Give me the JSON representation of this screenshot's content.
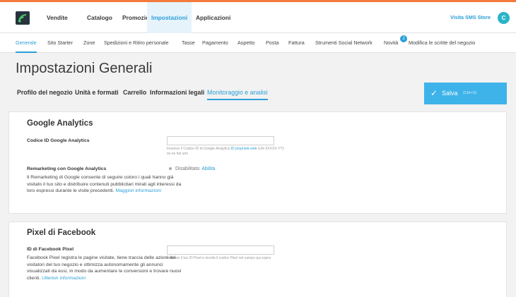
{
  "topnav": {
    "items": [
      "Vendite",
      "Catalogo",
      "Promozioni",
      "Impostazioni",
      "Applicazioni"
    ],
    "visit_store": "Visita SMS Store",
    "avatar_initial": "C"
  },
  "subnav": {
    "items": [
      "Generale",
      "Sito Starter",
      "Zone",
      "Spedizioni e Ritiro personale",
      "Tasse",
      "Pagamento",
      "Aspetto",
      "Posta",
      "Fattura",
      "Strumenti Social Network",
      "Novità",
      "Modifica le scritte del negozio"
    ],
    "news_badge": "2"
  },
  "page": {
    "title": "Impostazioni Generali",
    "tabs": [
      "Profilo del negozio",
      "Unità e formati",
      "Carrello",
      "Informazioni legali",
      "Monitoraggio e analisi"
    ],
    "save_label": "Salva",
    "save_shortcut": "(Ctrl+S)"
  },
  "google": {
    "title": "Google Analytics",
    "id_label": "Codice ID Google Analytics",
    "id_value": "",
    "id_hint": "Inserisci il Codice ID di Google Analytics,",
    "id_hint_link": "ID proprietà web",
    "id_hint_rest": " (UA-XXXXX-YY) se ne hai uno",
    "remarketing_label": "Remarketing con Google Analytics",
    "remarketing_desc": "Il Remarketing di Google consente di seguire coloro i quali hanno già visitato il tuo sito e distribuire contenuti pubblicitari mirati agli interessi da loro espressi durante le visite precedenti.",
    "remarketing_more": "Maggiori informazioni",
    "status": "Disabilitato",
    "enable": "Abilita"
  },
  "facebook": {
    "title": "Pixel di Facebook",
    "id_label": "ID di Facebook Pixel",
    "id_value": "",
    "desc": "Facebook Pixel registra le pagine visitate, tiene traccia delle azioni dei visitatori del tuo negozio e ottimizza autonomamente gli annunci visualizzati da essi, in modo da aumentare le conversioni e trovare nuovi clienti.",
    "more": "Ulteriori informazioni",
    "hint": "Inserisci il tuo ID Pixel o incolla il codice Pixel nel campo qui sopra"
  },
  "colors": {
    "accent": "#2c9fd8",
    "save_button": "#3eb3ea",
    "top_stripe": "#f47a3c",
    "avatar": "#2ab4c8"
  },
  "icons": {
    "logo": "store-logo-icon",
    "save": "check-icon"
  }
}
